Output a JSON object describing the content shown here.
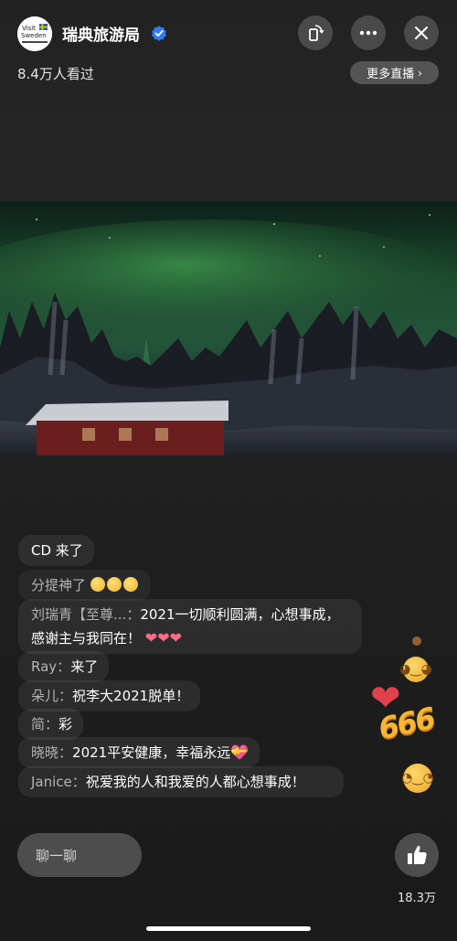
{
  "header": {
    "account_name": "瑞典旅游局",
    "viewers": "8.4万人看过",
    "more_live": "更多直播",
    "avatar_logo_text": "Visit Sweden"
  },
  "icons": {
    "avatar": "visit-sweden-logo",
    "verified": "verified-badge-icon",
    "rotate": "screen-rotate-icon",
    "more": "more-dots-icon",
    "close": "close-icon",
    "like": "thumbs-up-icon"
  },
  "comments": [
    {
      "text": "CD 来了"
    },
    {
      "text": "分提神了"
    },
    {
      "user": "刘瑞青【至尊...",
      "sep": "：",
      "text": "2021一切顺利圆满，心想事成，感谢主与我同在！"
    },
    {
      "user": "Ray",
      "sep": "：",
      "text": "来了"
    },
    {
      "user": "朵儿",
      "sep": "：",
      "text": "祝李大2021脱单！"
    },
    {
      "user": "简",
      "sep": "：",
      "text": "彩"
    },
    {
      "user": "晓晓",
      "sep": "：",
      "text": "2021平安健康，幸福永远"
    },
    {
      "user": "Janice",
      "sep": "：",
      "text": "祝爱我的人和我爱的人都心想事成！"
    }
  ],
  "floating": {
    "badge_666": "666"
  },
  "bottom": {
    "chat_placeholder": "聊一聊",
    "like_count": "18.3万"
  },
  "colors": {
    "accent_verified": "#2f7cf6",
    "aurora_green": "#3fae5a",
    "heart": "#e0414b"
  }
}
